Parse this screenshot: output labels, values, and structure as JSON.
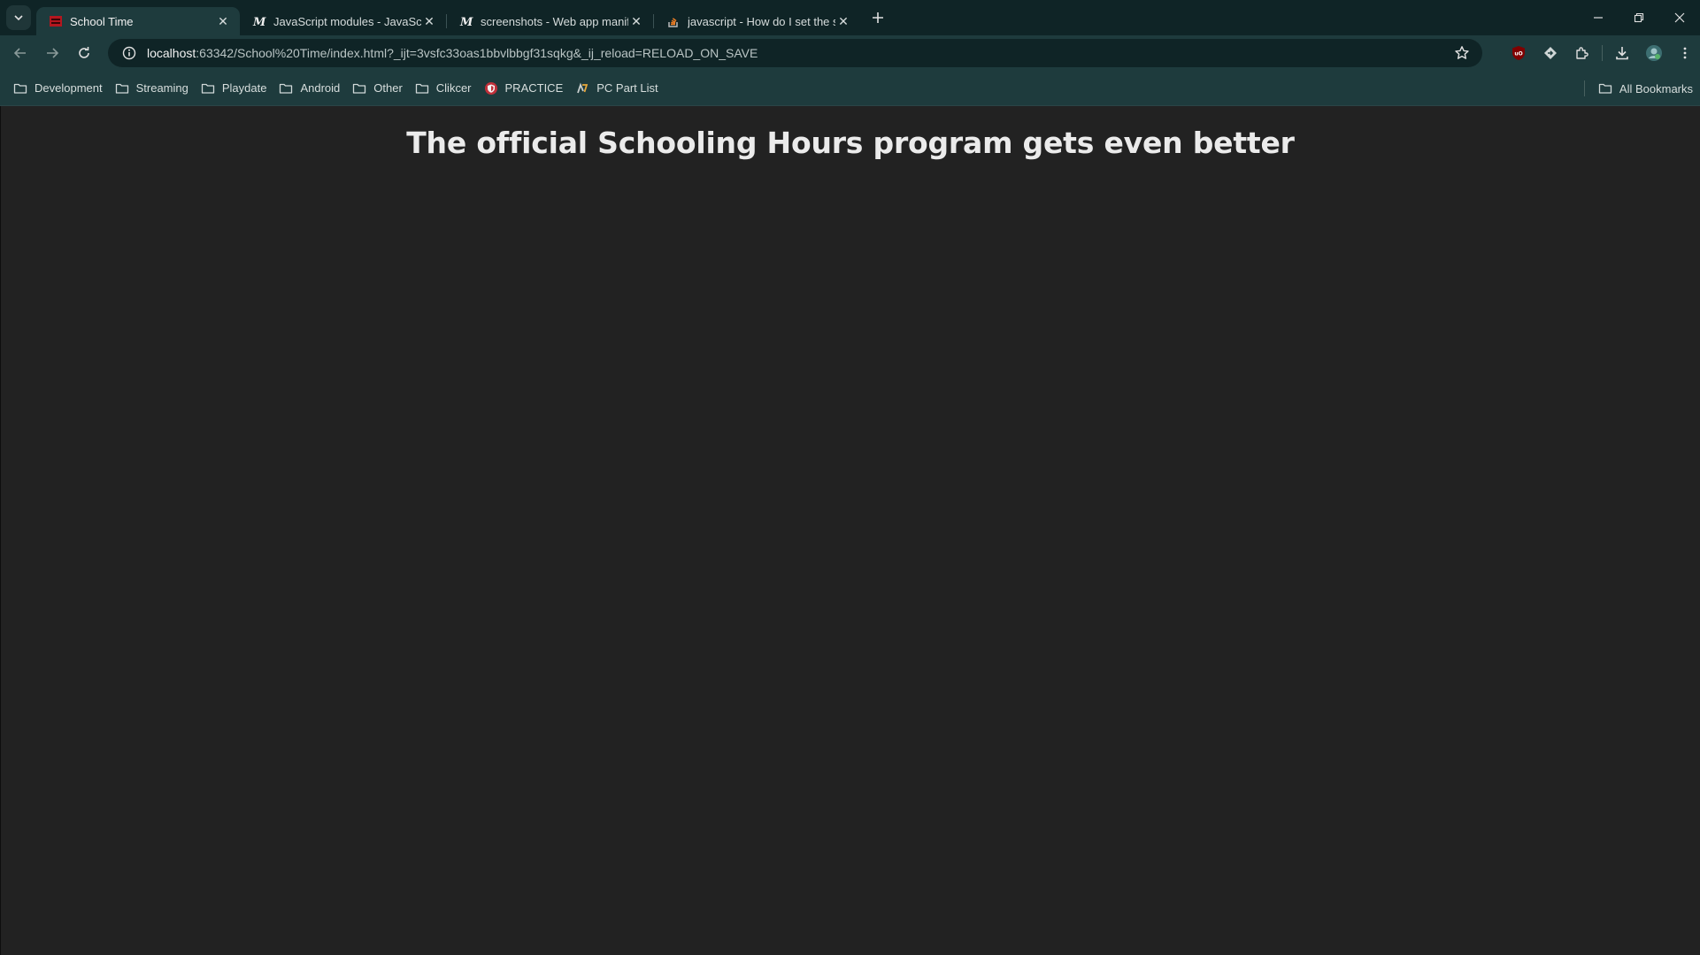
{
  "tabs": [
    {
      "title": "School Time",
      "active": true,
      "icon": "school-favicon"
    },
    {
      "title": "JavaScript modules - JavaScript",
      "active": false,
      "icon": "mdn-favicon"
    },
    {
      "title": "screenshots - Web app manifest",
      "active": false,
      "icon": "mdn-favicon"
    },
    {
      "title": "javascript - How do I set the start",
      "active": false,
      "icon": "stackoverflow-favicon"
    }
  ],
  "address": {
    "host": "localhost",
    "rest": ":63342/School%20Time/index.html?_ijt=3vsfc33oas1bbvlbbgf31sqkg&_ij_reload=RELOAD_ON_SAVE"
  },
  "bookmarks": [
    {
      "label": "Development",
      "icon": "folder-icon"
    },
    {
      "label": "Streaming",
      "icon": "folder-icon"
    },
    {
      "label": "Playdate",
      "icon": "folder-icon"
    },
    {
      "label": "Android",
      "icon": "folder-icon"
    },
    {
      "label": "Other",
      "icon": "folder-icon"
    },
    {
      "label": "Clikcer",
      "icon": "folder-icon"
    },
    {
      "label": "PRACTICE",
      "icon": "shield-favicon"
    },
    {
      "label": "PC Part List",
      "icon": "pcpartpicker-favicon"
    }
  ],
  "all_bookmarks_label": "All Bookmarks",
  "page": {
    "heading": "The official Schooling Hours program gets even better"
  },
  "colors": {
    "tabbar": "#0f2426",
    "toolbar": "#1e3b3d",
    "page_bg": "#222222",
    "heading": "#ebebeb"
  }
}
